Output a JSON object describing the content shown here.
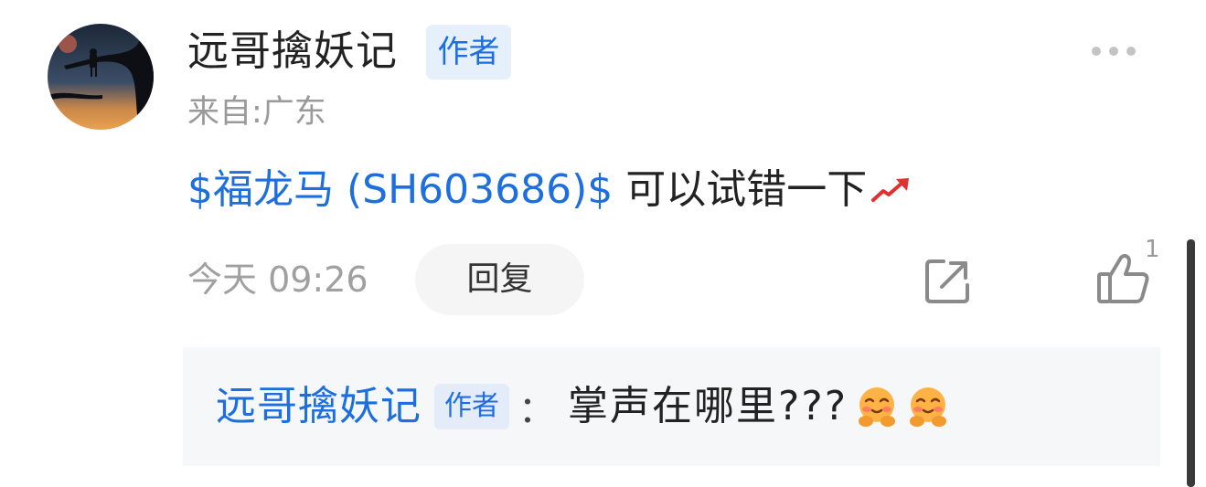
{
  "post": {
    "username": "远哥擒妖记",
    "author_badge": "作者",
    "location": "来自:广东",
    "stock_link": "$福龙马 (SH603686)$",
    "text": "可以试错一下",
    "timestamp": "今天 09:26",
    "reply_label": "回复",
    "like_count": "1"
  },
  "reply": {
    "username": "远哥擒妖记",
    "author_badge": "作者",
    "colon": "：",
    "text": "掌声在哪里???"
  },
  "icons": {
    "more": "more-dots-icon",
    "trend": "trend-up-icon",
    "share": "share-icon",
    "like": "thumbs-up-icon",
    "emoji": "blushing-hug-emoji-icon"
  },
  "colors": {
    "link_blue": "#1d6fe0",
    "badge_bg": "#e6f0fb",
    "reply_bg": "#f6f7f9",
    "muted_gray": "#9a9a9a",
    "trend_red": "#e03030"
  }
}
